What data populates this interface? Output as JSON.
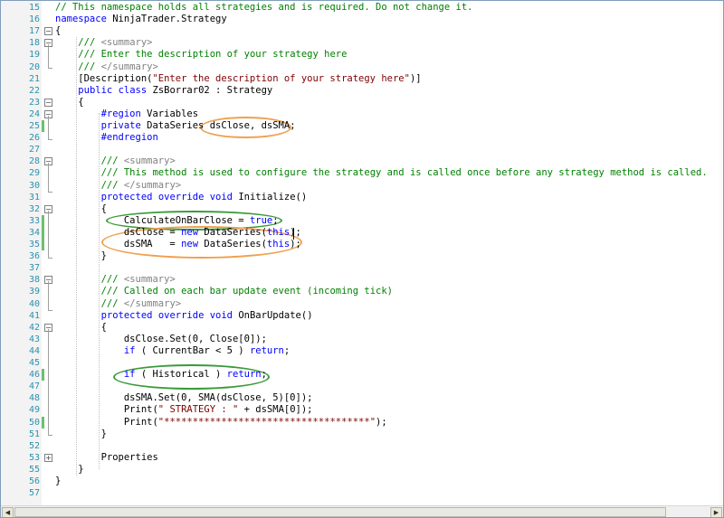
{
  "editor": {
    "lines": [
      {
        "n": "15",
        "text": "// This namespace holds all strategies and is required. Do not change it."
      },
      {
        "n": "16",
        "text": "namespace NinjaTrader.Strategy"
      },
      {
        "n": "17",
        "text": "{"
      },
      {
        "n": "18",
        "text": "    /// <summary>"
      },
      {
        "n": "19",
        "text": "    /// Enter the description of your strategy here"
      },
      {
        "n": "20",
        "text": "    /// </summary>"
      },
      {
        "n": "21",
        "text": "    [Description(\"Enter the description of your strategy here\")]"
      },
      {
        "n": "22",
        "text": "    public class ZsBorrar02 : Strategy"
      },
      {
        "n": "23",
        "text": "    {"
      },
      {
        "n": "24",
        "text": "        #region Variables"
      },
      {
        "n": "25",
        "text": "        private DataSeries dsClose, dsSMA;"
      },
      {
        "n": "26",
        "text": "        #endregion"
      },
      {
        "n": "27",
        "text": ""
      },
      {
        "n": "28",
        "text": "        /// <summary>"
      },
      {
        "n": "29",
        "text": "        /// This method is used to configure the strategy and is called once before any strategy method is called."
      },
      {
        "n": "30",
        "text": "        /// </summary>"
      },
      {
        "n": "31",
        "text": "        protected override void Initialize()"
      },
      {
        "n": "32",
        "text": "        {"
      },
      {
        "n": "33",
        "text": "            CalculateOnBarClose = true;"
      },
      {
        "n": "34",
        "text": "            dsClose = new DataSeries(this);"
      },
      {
        "n": "35",
        "text": "            dsSMA   = new DataSeries(this);"
      },
      {
        "n": "36",
        "text": "        }"
      },
      {
        "n": "37",
        "text": ""
      },
      {
        "n": "38",
        "text": "        /// <summary>"
      },
      {
        "n": "39",
        "text": "        /// Called on each bar update event (incoming tick)"
      },
      {
        "n": "40",
        "text": "        /// </summary>"
      },
      {
        "n": "41",
        "text": "        protected override void OnBarUpdate()"
      },
      {
        "n": "42",
        "text": "        {"
      },
      {
        "n": "43",
        "text": "            dsClose.Set(0, Close[0]);"
      },
      {
        "n": "44",
        "text": "            if ( CurrentBar < 5 ) return;"
      },
      {
        "n": "45",
        "text": ""
      },
      {
        "n": "46",
        "text": "            if ( Historical ) return;"
      },
      {
        "n": "47",
        "text": ""
      },
      {
        "n": "48",
        "text": "            dsSMA.Set(0, SMA(dsClose, 5)[0]);"
      },
      {
        "n": "49",
        "text": "            Print(\" STRATEGY : \" + dsSMA[0]);"
      },
      {
        "n": "50",
        "text": "            Print(\"************************************\");"
      },
      {
        "n": "51",
        "text": "        }"
      },
      {
        "n": "52",
        "text": ""
      },
      {
        "n": "53",
        "text": "        Properties"
      },
      {
        "n": "55",
        "text": "    }"
      },
      {
        "n": "56",
        "text": "}"
      },
      {
        "n": "57",
        "text": ""
      }
    ],
    "region_label": "Properties",
    "colors": {
      "comment": "#008000",
      "keyword": "#0000ff",
      "string": "#800000",
      "line_number": "#2b91af",
      "change_bar": "#6fbf6f",
      "highlight_orange": "#f0a050",
      "highlight_green": "#3a9a3a"
    }
  }
}
